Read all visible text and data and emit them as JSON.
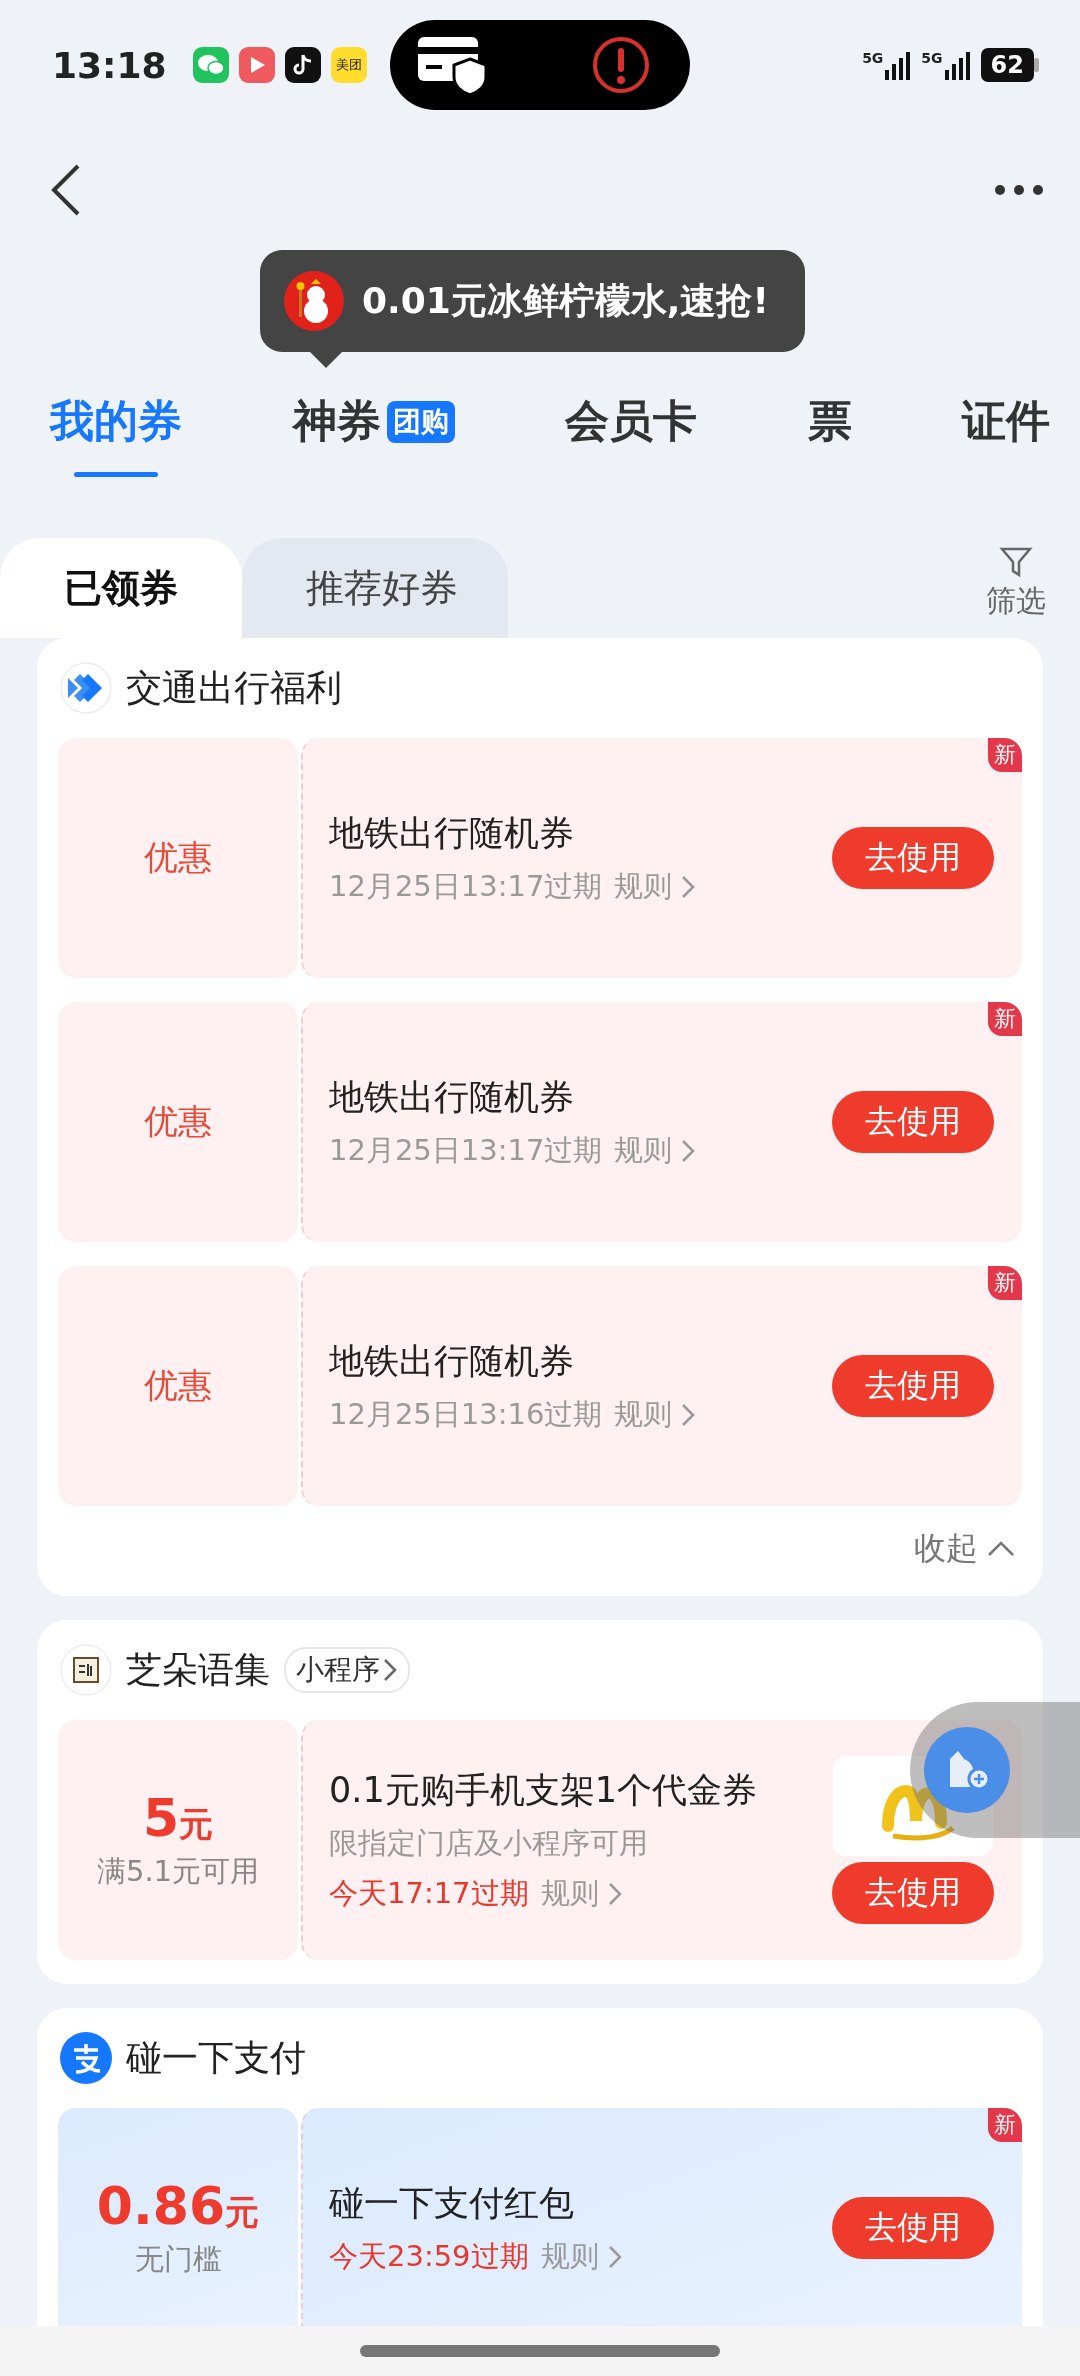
{
  "status_bar": {
    "time": "13:18",
    "app_icons": [
      {
        "kind": "chat"
      },
      {
        "kind": "video"
      },
      {
        "kind": "music"
      },
      {
        "kind": "text",
        "label": "美团"
      }
    ],
    "networks": [
      "5G",
      "5G"
    ],
    "battery": "62"
  },
  "tooltip": {
    "text": "0.01元冰鲜柠檬水,速抢!"
  },
  "tabs": [
    {
      "label": "我的券",
      "selected": true
    },
    {
      "label": "神券",
      "badge": "团购",
      "selected": false
    },
    {
      "label": "会员卡",
      "selected": false
    },
    {
      "label": "票",
      "selected": false
    },
    {
      "label": "证件",
      "selected": false
    }
  ],
  "subtabs": [
    {
      "label": "已领券",
      "selected": true
    },
    {
      "label": "推荐好券",
      "selected": false
    }
  ],
  "filter": {
    "label": "筛选"
  },
  "groups": [
    {
      "title": "交通出行福利",
      "collapse": "收起",
      "coupons": [
        {
          "kind": "label",
          "label": "优惠",
          "name": "地铁出行随机券",
          "expiry": "12月25日13:17过期",
          "expiry_urgent": false,
          "rules": "规则",
          "action": "去使用",
          "badge": "新"
        },
        {
          "kind": "label",
          "label": "优惠",
          "name": "地铁出行随机券",
          "expiry": "12月25日13:17过期",
          "expiry_urgent": false,
          "rules": "规则",
          "action": "去使用",
          "badge": "新"
        },
        {
          "kind": "label",
          "label": "优惠",
          "name": "地铁出行随机券",
          "expiry": "12月25日13:16过期",
          "expiry_urgent": false,
          "rules": "规则",
          "action": "去使用",
          "badge": "新"
        }
      ]
    },
    {
      "title": "芝朵语集",
      "tag": "小程序",
      "floating_widget": true,
      "coupons": [
        {
          "kind": "amount",
          "amount": "5",
          "unit": "元",
          "condition": "满5.1元可用",
          "name": "0.1元购手机支架1个代金券",
          "note": "限指定门店及小程序可用",
          "expiry": "今天17:17过期",
          "expiry_urgent": true,
          "rules": "规则",
          "action": "去使用",
          "thumbnail": true
        }
      ]
    },
    {
      "title": "碰一下支付",
      "coupons": [
        {
          "kind": "amount",
          "amount": "0.86",
          "unit": "元",
          "condition": "无门槛",
          "name": "碰一下支付红包",
          "expiry": "今天23:59过期",
          "expiry_urgent": true,
          "rules": "规则",
          "action": "去使用",
          "badge": "新"
        }
      ]
    }
  ]
}
